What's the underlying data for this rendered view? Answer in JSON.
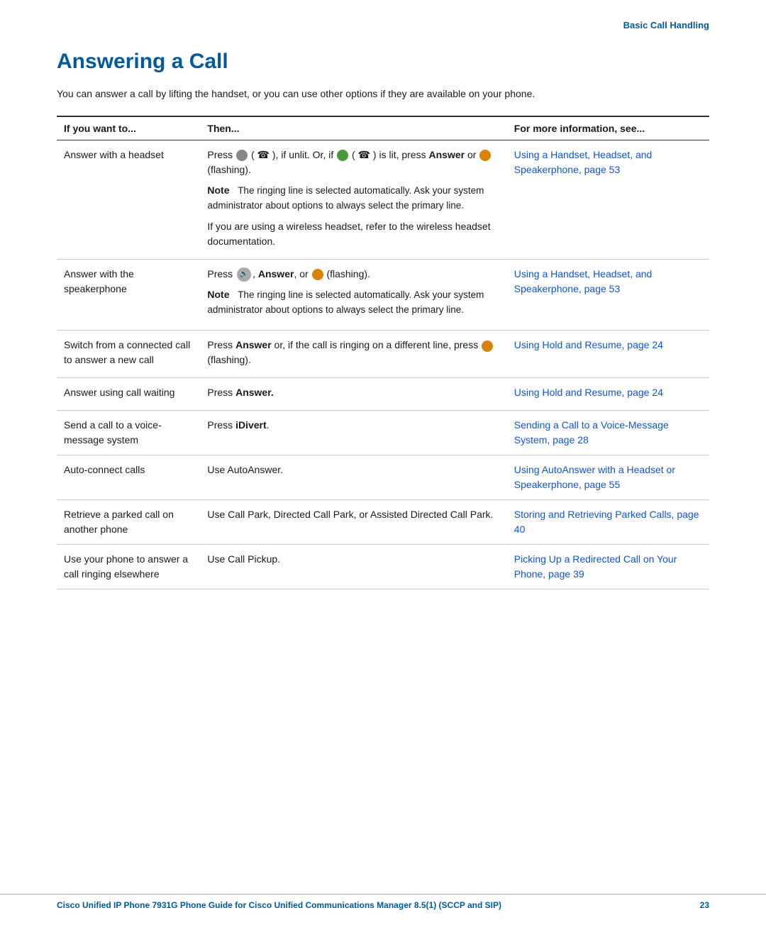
{
  "header": {
    "section_title": "Basic Call Handling"
  },
  "page": {
    "title": "Answering a Call",
    "intro": "You can answer a call by lifting the handset, or you can use other options if they are available on your phone."
  },
  "table": {
    "col1": "If you want to...",
    "col2": "Then...",
    "col3": "For more information, see...",
    "rows": [
      {
        "if": "Answer with a headset",
        "then_lines": [
          "Press [gray] ( [headset] ), if unlit. Or, if [green] ( [headset] ) is lit, press Answer or [orange] (flashing).",
          "Note: The ringing line is selected automatically. Ask your system administrator about options to always select the primary line.",
          "If you are using a wireless headset, refer to the wireless headset documentation."
        ],
        "see": "Using a Handset, Headset, and Speakerphone, page 53"
      },
      {
        "if": "Answer with the speakerphone",
        "then_lines": [
          "Press [speaker], Answer, or [orange] (flashing).",
          "Note: The ringing line is selected automatically. Ask your system administrator about options to always select the primary line."
        ],
        "see": "Using a Handset, Headset, and Speakerphone, page 53"
      },
      {
        "if": "Switch from a connected call to answer a new call",
        "then_lines": [
          "Press Answer or, if the call is ringing on a different line, press [orange] (flashing)."
        ],
        "see": "Using Hold and Resume, page 24"
      },
      {
        "if": "Answer using call waiting",
        "then_lines": [
          "Press Answer."
        ],
        "see": "Using Hold and Resume, page 24"
      },
      {
        "if": "Send a call to a voice-message system",
        "then_lines": [
          "Press iDivert."
        ],
        "see": "Sending a Call to a Voice-Message System, page 28"
      },
      {
        "if": "Auto-connect calls",
        "then_lines": [
          "Use AutoAnswer."
        ],
        "see": "Using AutoAnswer with a Headset or Speakerphone, page 55"
      },
      {
        "if": "Retrieve a parked call on another phone",
        "then_lines": [
          "Use Call Park, Directed Call Park, or Assisted Directed Call Park."
        ],
        "see": "Storing and Retrieving Parked Calls, page 40"
      },
      {
        "if": "Use your phone to answer a call ringing elsewhere",
        "then_lines": [
          "Use Call Pickup."
        ],
        "see": "Picking Up a Redirected Call on Your Phone, page 39"
      }
    ]
  },
  "footer": {
    "left": "Cisco Unified IP Phone 7931G Phone Guide for Cisco Unified Communications Manager 8.5(1) (SCCP and SIP)",
    "right": "23"
  }
}
